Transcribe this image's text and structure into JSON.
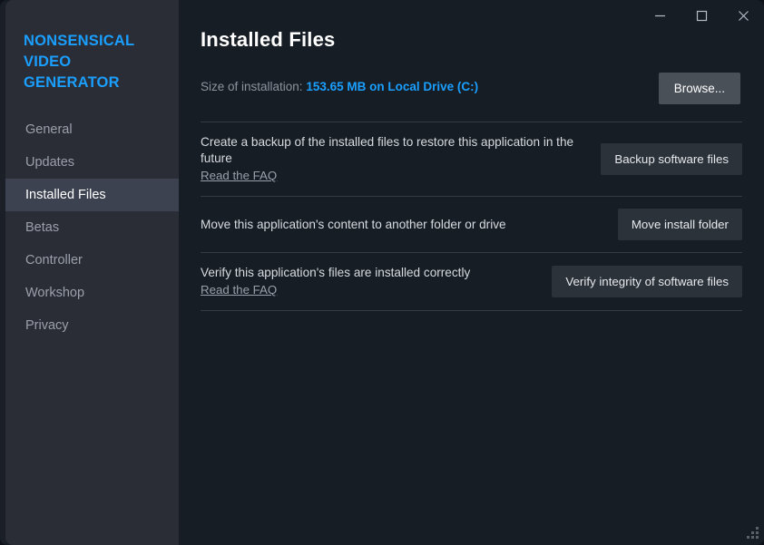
{
  "window": {
    "controls": {
      "minimize": "minimize-icon",
      "maximize": "maximize-icon",
      "close": "close-icon"
    },
    "resize_grip": "resize-grip-icon"
  },
  "sidebar": {
    "brand_lines": [
      "NONSENSICAL",
      "VIDEO",
      "GENERATOR"
    ],
    "brand_color": "#1a9fff",
    "items": [
      {
        "label": "General",
        "selected": false
      },
      {
        "label": "Updates",
        "selected": false
      },
      {
        "label": "Installed Files",
        "selected": true
      },
      {
        "label": "Betas",
        "selected": false
      },
      {
        "label": "Controller",
        "selected": false
      },
      {
        "label": "Workshop",
        "selected": false
      },
      {
        "label": "Privacy",
        "selected": false
      }
    ]
  },
  "main": {
    "title": "Installed Files",
    "size_label": "Size of installation:",
    "size_value": "153.65 MB on Local Drive (C:)",
    "browse_button": "Browse...",
    "rows": [
      {
        "desc": "Create a backup of the installed files to restore this application in the future",
        "link": "Read the FAQ",
        "action": "Backup software files"
      },
      {
        "desc": "Move this application's content to another folder or drive",
        "link": "",
        "action": "Move install folder"
      },
      {
        "desc": "Verify this application's files are installed correctly",
        "link": "Read the FAQ",
        "action": "Verify integrity of software files"
      }
    ]
  },
  "colors": {
    "sidebar_bg": "#2a2d36",
    "content_bg": "#171d25",
    "accent_blue": "#1a9fff",
    "selected_bg": "#3c4250",
    "button_bg": "#2c323a",
    "browse_bg": "#4a5058",
    "divider": "#343b45"
  }
}
